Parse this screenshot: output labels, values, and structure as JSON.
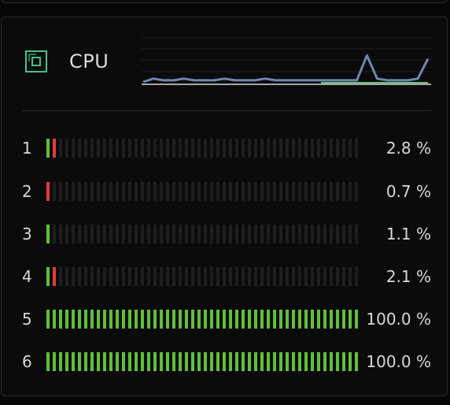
{
  "panel": {
    "title": "CPU",
    "icon": "cpu-icon",
    "history": [
      0,
      0.1,
      0.05,
      0.05,
      0.1,
      0.05,
      0.05,
      0.05,
      0.1,
      0.05,
      0.05,
      0.05,
      0.1,
      0.05,
      0.05,
      0.05,
      0.05,
      0.05,
      0.05,
      0.05,
      0.05,
      0.05,
      0.8,
      0.1,
      0.05,
      0.05,
      0.05,
      0.1,
      0.7
    ],
    "colors": {
      "history_line": "#6e86b2",
      "history_baseline": "#69c37a",
      "user": "#5fbf3a",
      "system": "#e23b3b",
      "empty": "#1e1e1e"
    }
  },
  "cores": [
    {
      "label": "1",
      "value": "2.8 %",
      "user_pct": 1.4,
      "system_pct": 1.4
    },
    {
      "label": "2",
      "value": "0.7 %",
      "user_pct": 0,
      "system_pct": 0.7
    },
    {
      "label": "3",
      "value": "1.1 %",
      "user_pct": 1.1,
      "system_pct": 0
    },
    {
      "label": "4",
      "value": "2.1 %",
      "user_pct": 1.05,
      "system_pct": 1.05
    },
    {
      "label": "5",
      "value": "100.0 %",
      "user_pct": 100,
      "system_pct": 0
    },
    {
      "label": "6",
      "value": "100.0 %",
      "user_pct": 100,
      "system_pct": 0
    }
  ]
}
